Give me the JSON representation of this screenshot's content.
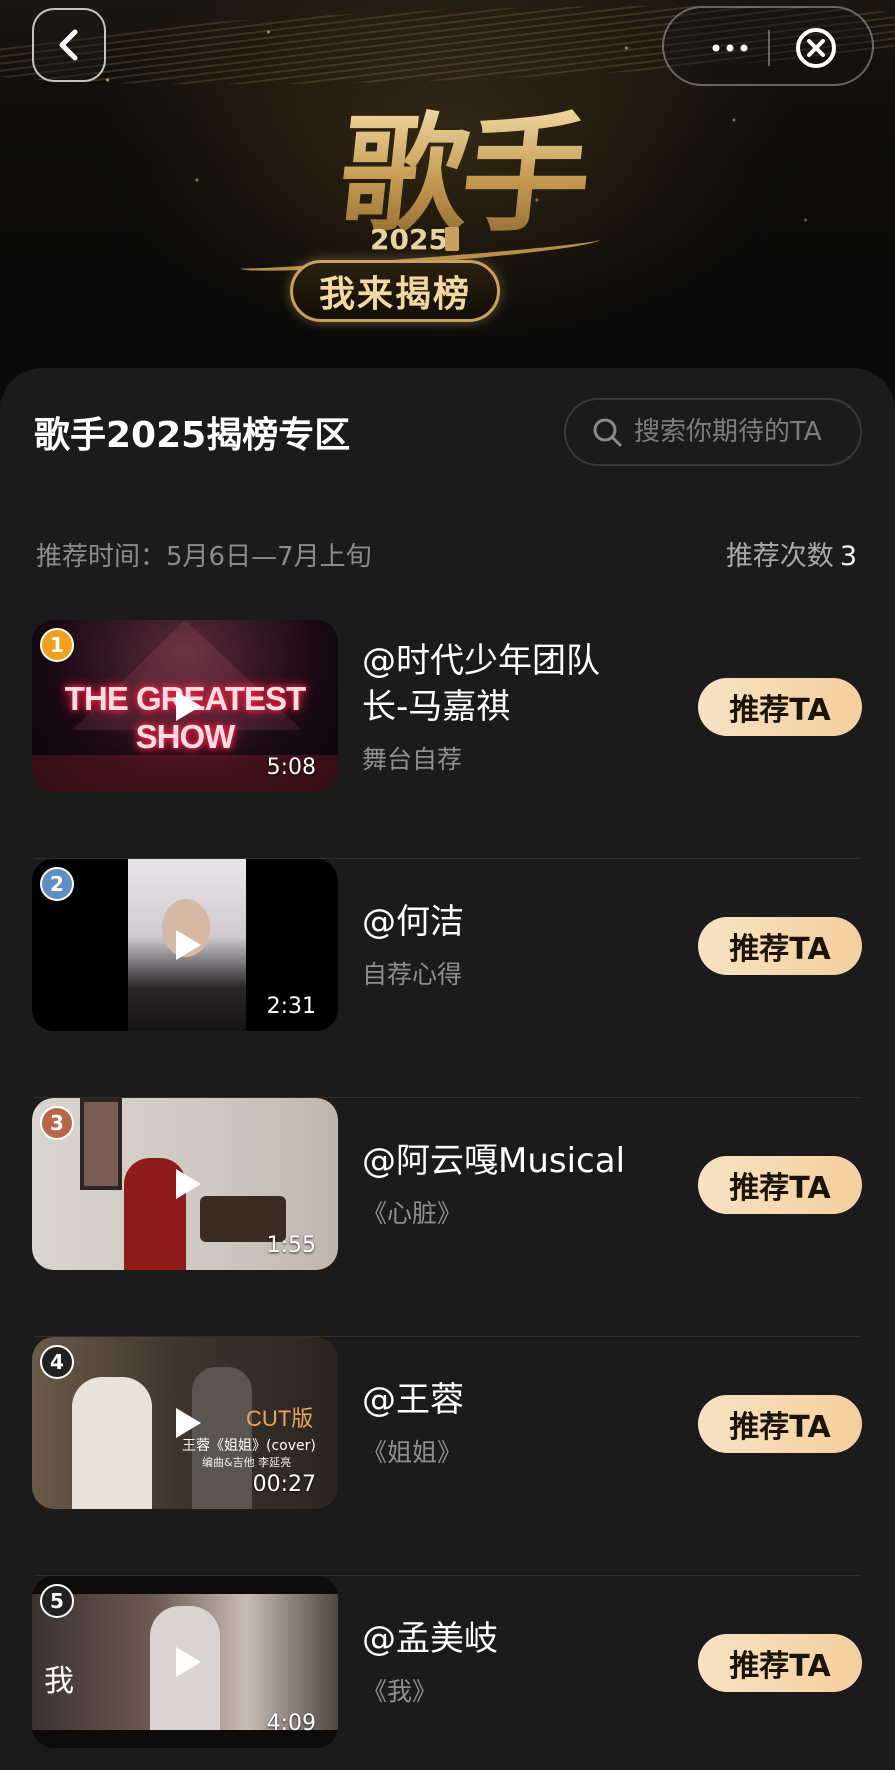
{
  "header": {
    "logo_title": "歌手",
    "logo_year": "2025",
    "logo_subtitle": "我来揭榜"
  },
  "panel": {
    "title": "歌手2025揭榜专区",
    "search_placeholder": "搜索你期待的TA",
    "recommend_time_label": "推荐时间：5月6日—7月上旬",
    "recommend_count_label": "推荐次数",
    "recommend_count_value": "3"
  },
  "colors": {
    "accent_gold": "#c9a25f",
    "button_gradient_start": "#f7e2c4",
    "button_gradient_end": "#f4cf9d",
    "rank1": "#f0a01c",
    "rank2": "#5d8fc2",
    "rank3": "#b7664a",
    "rank_default": "#222222"
  },
  "items": [
    {
      "rank": "1",
      "name": "@时代少年团队长-马嘉祺",
      "subtitle": "舞台自荐",
      "duration": "5:08",
      "thumb_text": "THE GREATEST SHOW",
      "button": "推荐TA"
    },
    {
      "rank": "2",
      "name": "@何洁",
      "subtitle": "自荐心得",
      "duration": "2:31",
      "button": "推荐TA"
    },
    {
      "rank": "3",
      "name": "@阿云嘎Musical",
      "subtitle": "《心脏》",
      "duration": "1:55",
      "button": "推荐TA"
    },
    {
      "rank": "4",
      "name": "@王蓉",
      "subtitle": "《姐姐》",
      "duration": "00:27",
      "thumb_text": "CUT版",
      "thumb_caption": "王蓉《姐姐》(cover)",
      "thumb_credit": "编曲&吉他 李延亮",
      "button": "推荐TA"
    },
    {
      "rank": "5",
      "name": "@孟美岐",
      "subtitle": "《我》",
      "duration": "4:09",
      "thumb_text": "我",
      "button": "推荐TA"
    }
  ]
}
